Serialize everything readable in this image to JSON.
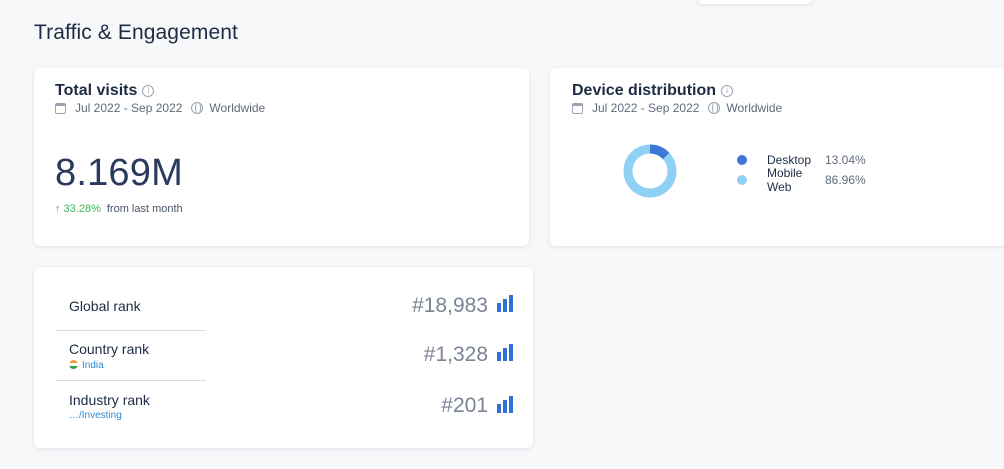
{
  "section": {
    "title": "Traffic & Engagement"
  },
  "visits": {
    "title": "Total visits",
    "info_glyph": "i",
    "date_range": "Jul 2022 - Sep 2022",
    "region": "Worldwide",
    "value": "8.169M",
    "change": "↑ 33.28%",
    "change_suffix": "from last month",
    "change_color": "#3cb454"
  },
  "device": {
    "title": "Device distribution",
    "info_glyph": "i",
    "date_range": "Jul 2022 - Sep 2022",
    "region": "Worldwide",
    "items": [
      {
        "label": "Desktop",
        "value": "13.04%",
        "share": 0.1304,
        "color": "#3d78d8"
      },
      {
        "label": "Mobile Web",
        "value": "86.96%",
        "share": 0.8696,
        "color": "#8fd0f5"
      }
    ]
  },
  "ranks": {
    "bar_color": "#2f6fd6",
    "items": [
      {
        "label": "Global rank",
        "sub": "",
        "value": "#18,983"
      },
      {
        "label": "Country rank",
        "sub": "India",
        "value": "#1,328"
      },
      {
        "label": "Industry rank",
        "sub": "…/Investing",
        "value": "#201"
      }
    ]
  }
}
